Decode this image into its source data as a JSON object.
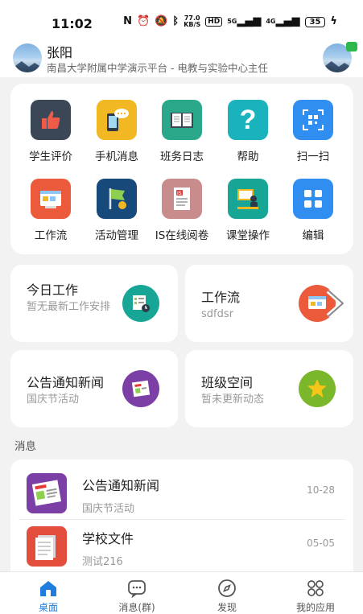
{
  "status_bar": {
    "time": "11:02",
    "net_speed_value": "77.0",
    "net_speed_unit": "KB/S",
    "hd_label": "HD",
    "signal1_label": "5G",
    "signal2_label": "4G",
    "battery": "35"
  },
  "header": {
    "user_name": "张阳",
    "org_line": "南昌大学附属中学演示平台 - 电教与实验中心主任"
  },
  "apps": [
    {
      "label": "学生评价",
      "icon": "thumbs-up-icon",
      "color": "#3b4756"
    },
    {
      "label": "手机消息",
      "icon": "phone-message-icon",
      "color": "#f2b824"
    },
    {
      "label": "班务日志",
      "icon": "open-book-icon",
      "color": "#2aa889"
    },
    {
      "label": "帮助",
      "icon": "question-icon",
      "color": "#1ab3bd"
    },
    {
      "label": "扫一扫",
      "icon": "qr-scan-icon",
      "color": "#2f8ef0"
    },
    {
      "label": "工作流",
      "icon": "workflow-icon",
      "color": "#ea5a3b"
    },
    {
      "label": "活动管理",
      "icon": "flag-icon",
      "color": "#17497a"
    },
    {
      "label": "IS在线阅卷",
      "icon": "exam-paper-icon",
      "color": "#c98c8c"
    },
    {
      "label": "课堂操作",
      "icon": "classroom-icon",
      "color": "#17a596"
    },
    {
      "label": "编辑",
      "icon": "grid-edit-icon",
      "color": "#2f8ef0"
    }
  ],
  "work_cards": {
    "today": {
      "title": "今日工作",
      "subtitle": "暂无最新工作安排"
    },
    "workflow": {
      "title": "工作流",
      "subtitle": "sdfdsr"
    },
    "notice": {
      "title": "公告通知新闻",
      "subtitle": "国庆节活动"
    },
    "class_space": {
      "title": "班级空间",
      "subtitle": "暂未更新动态"
    }
  },
  "messages": {
    "section_title": "消息",
    "items": [
      {
        "title": "公告通知新闻",
        "subtitle": "国庆节活动",
        "date": "10-28"
      },
      {
        "title": "学校文件",
        "subtitle": "测试216",
        "date": "05-05"
      }
    ]
  },
  "bottom_nav": [
    {
      "label": "桌面",
      "icon": "home-icon",
      "active": true
    },
    {
      "label": "消息(群)",
      "icon": "chat-icon",
      "active": false
    },
    {
      "label": "发现",
      "icon": "compass-icon",
      "active": false
    },
    {
      "label": "我的应用",
      "icon": "apps-icon",
      "active": false
    }
  ],
  "colors": {
    "accent": "#1f7de0",
    "bg": "#f2f2f2"
  }
}
